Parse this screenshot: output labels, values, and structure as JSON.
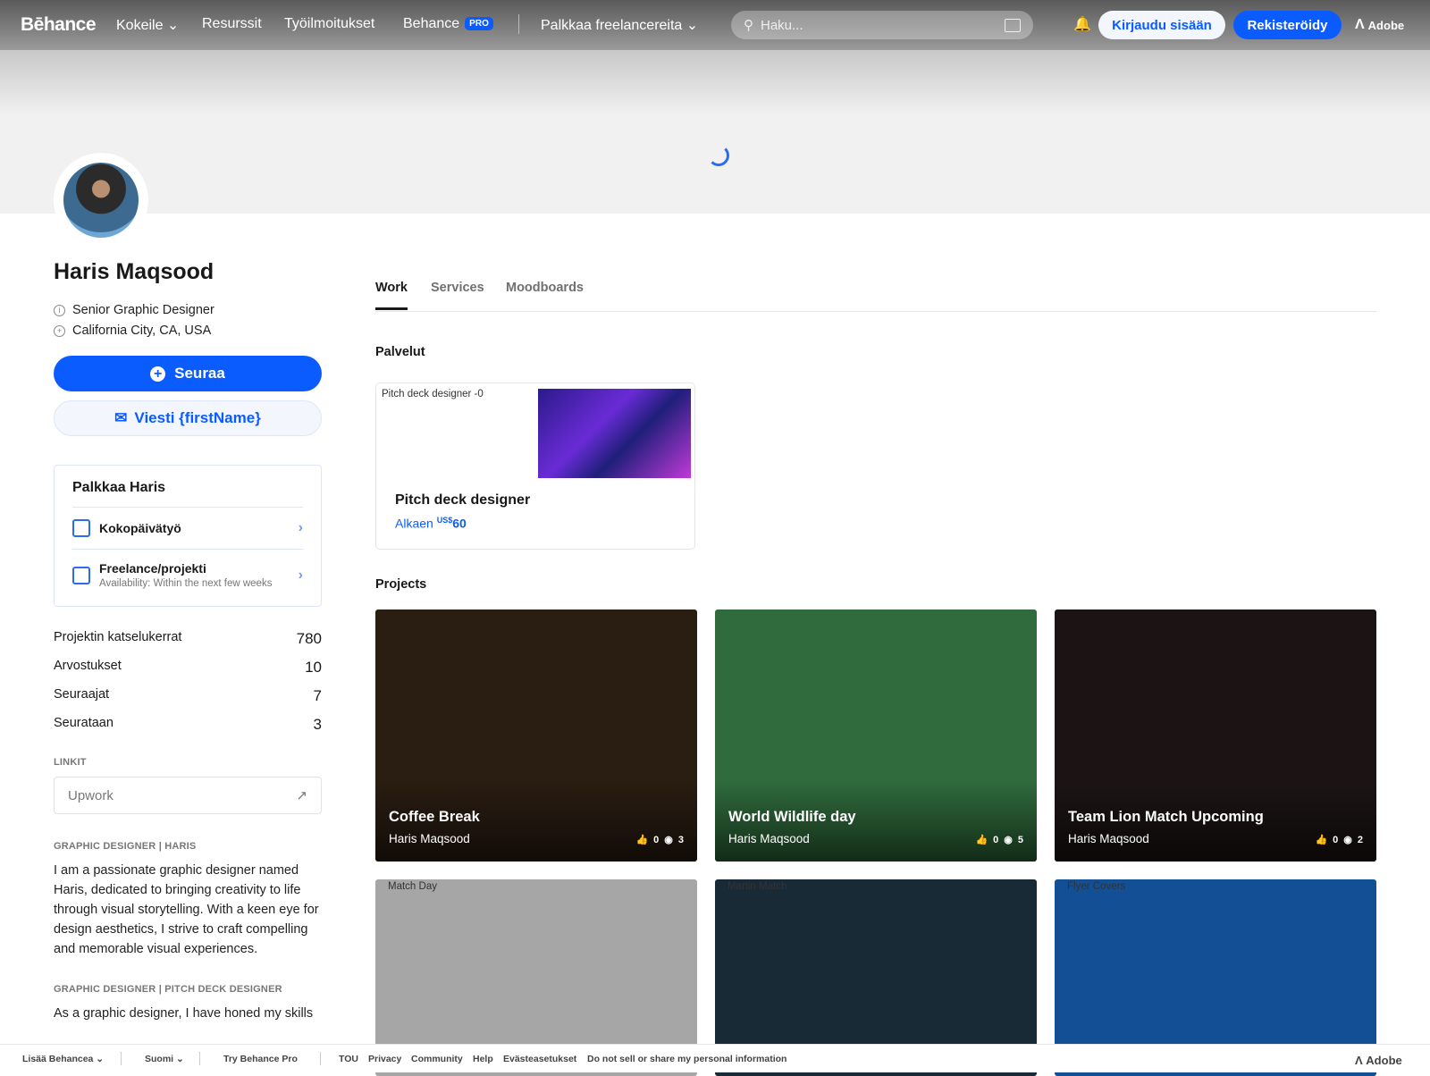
{
  "header": {
    "logo": "Bēhance",
    "nav": [
      {
        "label": "Kokeile ⌄"
      },
      {
        "label": "Resurssit"
      },
      {
        "label": "Työilmoitukset"
      },
      {
        "label": "Behance",
        "badge": "PRO"
      },
      {
        "label": "Palkkaa freelancereita ⌄"
      }
    ],
    "search_placeholder": "Haku...",
    "login": "Kirjaudu sisään",
    "register": "Rekisteröidy",
    "adobe": "Adobe"
  },
  "profile": {
    "name": "Haris Maqsood",
    "title": "Senior Graphic Designer",
    "location": "California City, CA, USA",
    "follow": "Seuraa",
    "message": "Viesti {firstName}",
    "hire": {
      "title": "Palkkaa Haris",
      "options": [
        {
          "label": "Kokopäivätyö"
        },
        {
          "label": "Freelance/projekti",
          "sub": "Availability: Within the next few weeks"
        }
      ]
    },
    "stats": [
      {
        "label": "Projektin katselukerrat",
        "value": "780"
      },
      {
        "label": "Arvostukset",
        "value": "10"
      },
      {
        "label": "Seuraajat",
        "value": "7"
      },
      {
        "label": "Seurataan",
        "value": "3"
      }
    ],
    "links_caption": "LINKIT",
    "links": [
      {
        "label": "Upwork"
      }
    ],
    "bio": [
      {
        "caption": "GRAPHIC DESIGNER | HARIS",
        "text": "I am a passionate graphic designer named Haris, dedicated to bringing creativity to life through visual storytelling. With a keen eye for design aesthetics, I strive to craft compelling and memorable visual experiences."
      },
      {
        "caption": "GRAPHIC DESIGNER | PITCH DECK DESIGNER",
        "text": "As a graphic designer, I have honed my skills"
      }
    ]
  },
  "tabs": [
    {
      "label": "Work"
    },
    {
      "label": "Services"
    },
    {
      "label": "Moodboards"
    }
  ],
  "services": {
    "heading": "Palvelut",
    "card": {
      "alt": "Pitch deck designer -0",
      "title": "Pitch deck designer",
      "price_prefix": "Alkaen",
      "currency": "US$",
      "price": "60"
    }
  },
  "projects": {
    "heading": "Projects",
    "items": [
      {
        "title": "Coffee Break",
        "author": "Haris Maqsood",
        "likes": "0",
        "views": "3",
        "color": "#2a1d12"
      },
      {
        "title": "World Wildlife day",
        "author": "Haris Maqsood",
        "likes": "0",
        "views": "5",
        "color": "#2f6b3c"
      },
      {
        "title": "Team Lion Match Upcoming",
        "author": "Haris Maqsood",
        "likes": "0",
        "views": "2",
        "color": "#1c1414"
      },
      {
        "alt": "Match Day",
        "color": "#a6a6a6"
      },
      {
        "alt": "Martin Match",
        "color": "#182a36"
      },
      {
        "alt": "Flyer Covers",
        "color": "#134f94"
      }
    ]
  },
  "footer": {
    "more": "Lisää Behancea ⌄",
    "lang": "Suomi ⌄",
    "pro": "Try Behance Pro",
    "links": [
      "TOU",
      "Privacy",
      "Community",
      "Help",
      "Evästeasetukset",
      "Do not sell or share my personal information"
    ],
    "adobe": "Adobe"
  }
}
